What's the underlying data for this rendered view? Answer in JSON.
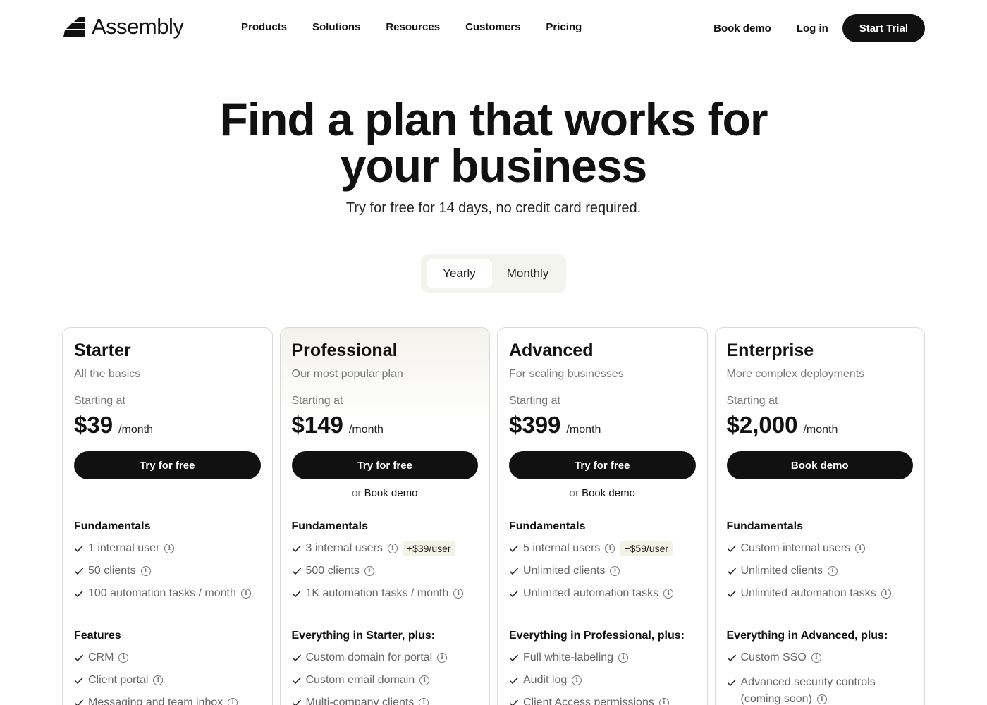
{
  "nav": {
    "logo_text": "Assembly",
    "links": [
      "Products",
      "Solutions",
      "Resources",
      "Customers",
      "Pricing"
    ],
    "book_demo": "Book demo",
    "login": "Log in",
    "start_trial": "Start Trial"
  },
  "hero": {
    "title_line1": "Find a plan that works for",
    "title_line2": "your business",
    "subtitle": "Try for free for 14 days, no credit card required."
  },
  "billing_toggle": {
    "options": [
      "Yearly",
      "Monthly"
    ],
    "selected": "Yearly"
  },
  "plans": [
    {
      "name": "Starter",
      "desc": "All the basics",
      "starting": "Starting at",
      "price": "$39",
      "per": "/month",
      "cta": "Try for free",
      "or_text": "",
      "or_link": "",
      "fundamentals_title": "Fundamentals",
      "fundamentals": [
        {
          "text": "1 internal user",
          "badge": ""
        },
        {
          "text": "50 clients",
          "badge": ""
        },
        {
          "text": "100 automation tasks / month",
          "badge": ""
        }
      ],
      "features_title": "Features",
      "features": [
        "CRM",
        "Client portal",
        "Messaging and team inbox"
      ]
    },
    {
      "name": "Professional",
      "desc": "Our most popular plan",
      "starting": "Starting at",
      "price": "$149",
      "per": "/month",
      "cta": "Try for free",
      "or_text": "or",
      "or_link": "Book demo",
      "fundamentals_title": "Fundamentals",
      "fundamentals": [
        {
          "text": "3 internal users",
          "badge": "+$39/user"
        },
        {
          "text": "500 clients",
          "badge": ""
        },
        {
          "text": "1K automation tasks / month",
          "badge": ""
        }
      ],
      "features_title": "Everything in Starter, plus:",
      "features": [
        "Custom domain for portal",
        "Custom email domain",
        "Multi-company clients"
      ]
    },
    {
      "name": "Advanced",
      "desc": "For scaling businesses",
      "starting": "Starting at",
      "price": "$399",
      "per": "/month",
      "cta": "Try for free",
      "or_text": "or",
      "or_link": "Book demo",
      "fundamentals_title": "Fundamentals",
      "fundamentals": [
        {
          "text": "5 internal users",
          "badge": "+$59/user"
        },
        {
          "text": "Unlimited clients",
          "badge": ""
        },
        {
          "text": "Unlimited automation tasks",
          "badge": ""
        }
      ],
      "features_title": "Everything in Professional, plus:",
      "features": [
        "Full white-labeling",
        "Audit log",
        "Client Access permissions"
      ]
    },
    {
      "name": "Enterprise",
      "desc": "More complex deployments",
      "starting": "Starting at",
      "price": "$2,000",
      "per": "/month",
      "cta": "Book demo",
      "or_text": "",
      "or_link": "",
      "fundamentals_title": "Fundamentals",
      "fundamentals": [
        {
          "text": "Custom internal users",
          "badge": ""
        },
        {
          "text": "Unlimited clients",
          "badge": ""
        },
        {
          "text": "Unlimited automation tasks",
          "badge": ""
        }
      ],
      "features_title": "Everything in Advanced, plus:",
      "features": [
        "Custom SSO",
        "Advanced security controls (coming soon)"
      ]
    }
  ]
}
